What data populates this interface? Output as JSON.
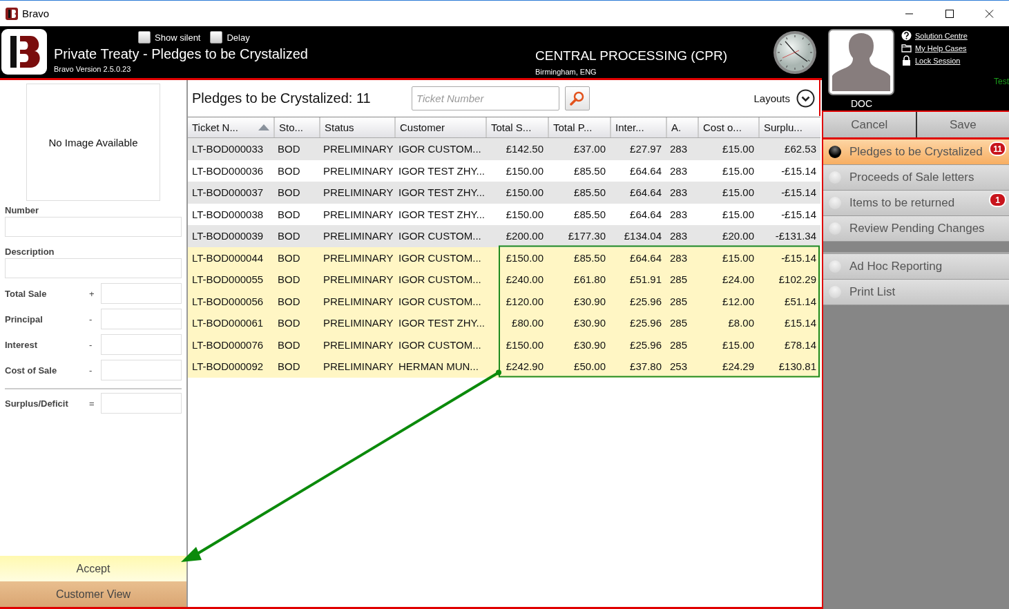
{
  "window": {
    "title": "Bravo"
  },
  "header": {
    "options": [
      {
        "label": "Show silent",
        "checked": false
      },
      {
        "label": "Delay",
        "checked": false
      }
    ],
    "title": "Private Treaty - Pledges to be Crystalized",
    "version": "Bravo Version 2.5.0.23",
    "branch": "CENTRAL PROCESSING (CPR)",
    "location": "Birmingham, ENG"
  },
  "profile": {
    "user": "DOC",
    "environment": "Test",
    "links": [
      {
        "label": "Solution Centre",
        "kind": "help"
      },
      {
        "label": "My Help Cases",
        "kind": "folder"
      },
      {
        "label": "Lock Session",
        "kind": "lock"
      }
    ]
  },
  "actions": [
    {
      "label": "Cancel"
    },
    {
      "label": "Save"
    }
  ],
  "details": {
    "image_text": "No Image Available",
    "fields": [
      {
        "label": "Number",
        "kind": "text"
      },
      {
        "label": "Description",
        "kind": "text"
      },
      {
        "label": "Total Sale",
        "kind": "amount",
        "sign": "+"
      },
      {
        "label": "Principal",
        "kind": "amount",
        "sign": "-"
      },
      {
        "label": "Interest",
        "kind": "amount",
        "sign": "-"
      },
      {
        "label": "Cost of Sale",
        "kind": "amount",
        "sign": "-"
      },
      {
        "label": "Surplus/Deficit",
        "kind": "total",
        "sign": "="
      }
    ],
    "buttons": [
      {
        "label": "Accept",
        "kind": "primary"
      },
      {
        "label": "Customer View",
        "kind": "secondary"
      }
    ]
  },
  "grid": {
    "title": "Pledges to be Crystalized: 11",
    "search": {
      "placeholder": "Ticket Number"
    },
    "layouts": "Layouts",
    "columns": [
      {
        "label": "Ticket N...",
        "right_aligned": false,
        "sorted": true
      },
      {
        "label": "Sto...",
        "right_aligned": false,
        "sorted": false
      },
      {
        "label": "Status",
        "right_aligned": false,
        "sorted": false
      },
      {
        "label": "Customer",
        "right_aligned": false,
        "sorted": false
      },
      {
        "label": "Total S...",
        "right_aligned": true,
        "sorted": false
      },
      {
        "label": "Total P...",
        "right_aligned": true,
        "sorted": false
      },
      {
        "label": "Inter...",
        "right_aligned": true,
        "sorted": false
      },
      {
        "label": "A.",
        "right_aligned": false,
        "sorted": false
      },
      {
        "label": "Cost o...",
        "right_aligned": true,
        "sorted": false
      },
      {
        "label": "Surplu...",
        "right_aligned": true,
        "sorted": false
      }
    ],
    "rows": [
      {
        "highlighted": false,
        "cells": [
          "LT-BOD000033",
          "BOD",
          "PRELIMINARY",
          "IGOR CUSTOM...",
          "£142.50",
          "£37.00",
          "£27.97",
          "283",
          "£15.00",
          "£62.53"
        ]
      },
      {
        "highlighted": false,
        "cells": [
          "LT-BOD000036",
          "BOD",
          "PRELIMINARY",
          "IGOR TEST ZHY...",
          "£150.00",
          "£85.50",
          "£64.64",
          "283",
          "£15.00",
          "-£15.14"
        ]
      },
      {
        "highlighted": false,
        "cells": [
          "LT-BOD000037",
          "BOD",
          "PRELIMINARY",
          "IGOR TEST ZHY...",
          "£150.00",
          "£85.50",
          "£64.64",
          "283",
          "£15.00",
          "-£15.14"
        ]
      },
      {
        "highlighted": false,
        "cells": [
          "LT-BOD000038",
          "BOD",
          "PRELIMINARY",
          "IGOR TEST ZHY...",
          "£150.00",
          "£85.50",
          "£64.64",
          "283",
          "£15.00",
          "-£15.14"
        ]
      },
      {
        "highlighted": false,
        "cells": [
          "LT-BOD000039",
          "BOD",
          "PRELIMINARY",
          "IGOR CUSTOM...",
          "£200.00",
          "£177.30",
          "£134.04",
          "283",
          "£20.00",
          "-£131.34"
        ]
      },
      {
        "highlighted": true,
        "cells": [
          "LT-BOD000044",
          "BOD",
          "PRELIMINARY",
          "IGOR CUSTOM...",
          "£150.00",
          "£85.50",
          "£64.64",
          "283",
          "£15.00",
          "-£15.14"
        ]
      },
      {
        "highlighted": true,
        "cells": [
          "LT-BOD000055",
          "BOD",
          "PRELIMINARY",
          "IGOR CUSTOM...",
          "£240.00",
          "£61.80",
          "£51.91",
          "285",
          "£24.00",
          "£102.29"
        ]
      },
      {
        "highlighted": true,
        "cells": [
          "LT-BOD000056",
          "BOD",
          "PRELIMINARY",
          "IGOR CUSTOM...",
          "£120.00",
          "£30.90",
          "£25.96",
          "285",
          "£12.00",
          "£51.14"
        ]
      },
      {
        "highlighted": true,
        "cells": [
          "LT-BOD000061",
          "BOD",
          "PRELIMINARY",
          "IGOR TEST ZHY...",
          "£80.00",
          "£30.90",
          "£25.96",
          "285",
          "£8.00",
          "£15.14"
        ]
      },
      {
        "highlighted": true,
        "cells": [
          "LT-BOD000076",
          "BOD",
          "PRELIMINARY",
          "IGOR CUSTOM...",
          "£150.00",
          "£30.90",
          "£25.96",
          "285",
          "£15.00",
          "£78.14"
        ]
      },
      {
        "highlighted": true,
        "cells": [
          "LT-BOD000092",
          "BOD",
          "PRELIMINARY",
          "HERMAN MUN...",
          "£242.90",
          "£50.00",
          "£37.80",
          "253",
          "£24.29",
          "£130.81"
        ]
      }
    ],
    "annotation": {
      "kind": "box-and-arrow"
    }
  },
  "nav": {
    "groups": [
      {
        "items": [
          {
            "label": "Pledges to be Crystalized",
            "selected": true,
            "badge": "11"
          },
          {
            "label": "Proceeds of Sale letters",
            "selected": false
          },
          {
            "label": "Items to be returned",
            "selected": false,
            "badge": "1"
          },
          {
            "label": "Review Pending Changes",
            "selected": false
          }
        ]
      },
      {
        "items": [
          {
            "label": "Ad Hoc Reporting",
            "selected": false
          },
          {
            "label": "Print List",
            "selected": false
          }
        ]
      }
    ]
  }
}
